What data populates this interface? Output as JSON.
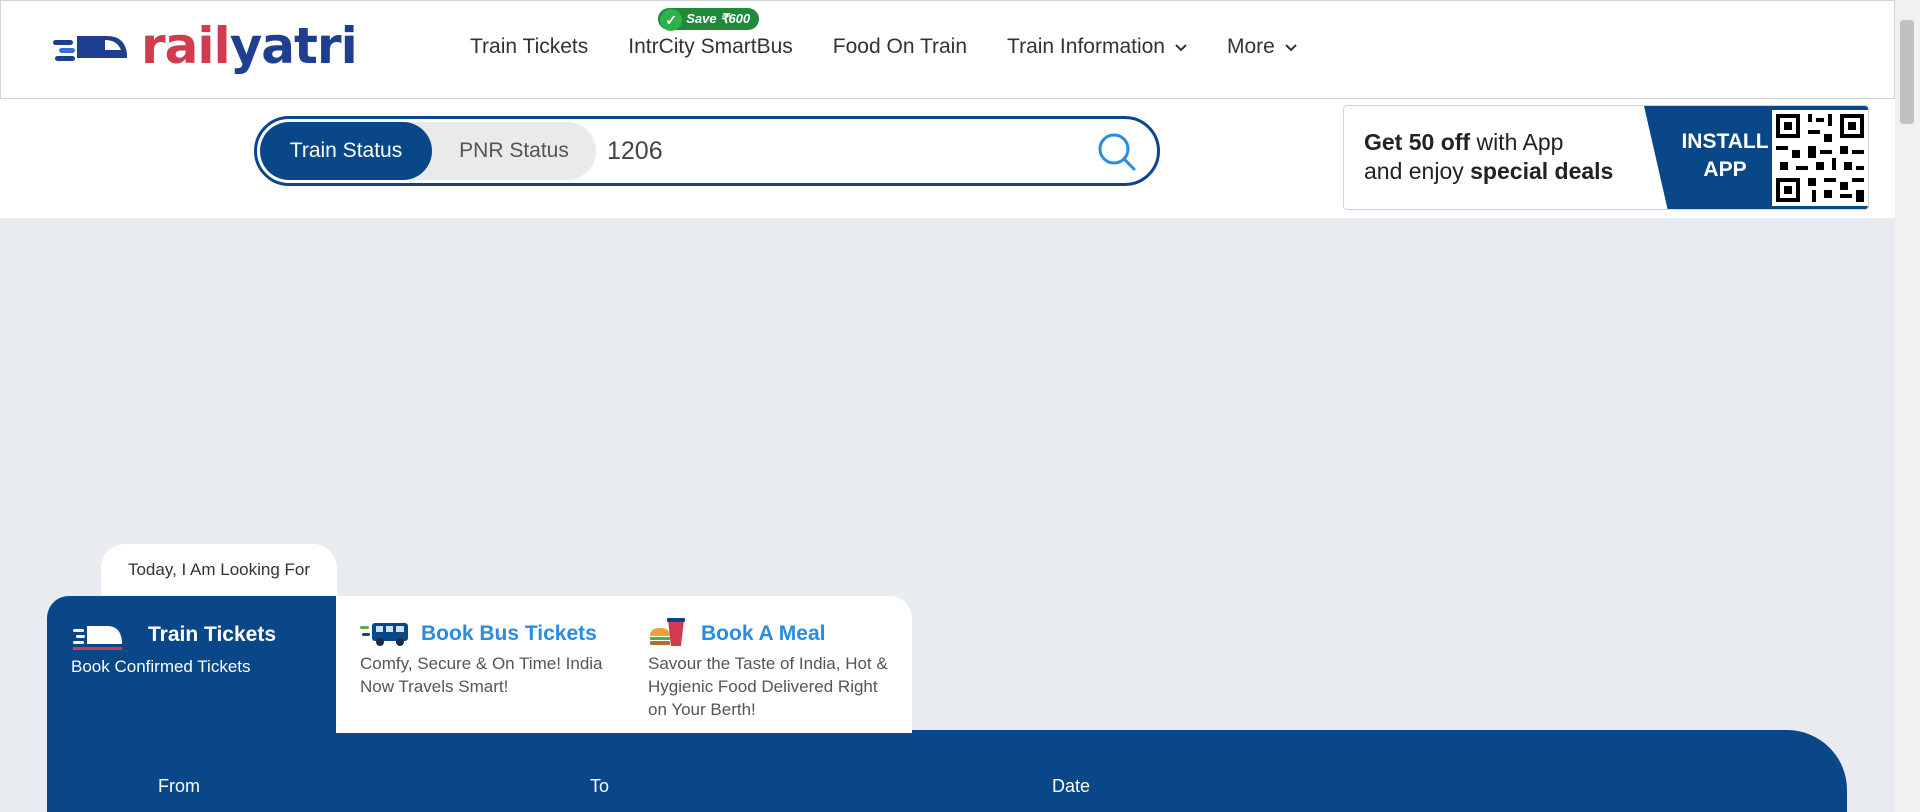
{
  "brand": {
    "part1": "rail",
    "part2": "yatri"
  },
  "nav": {
    "items": [
      {
        "label": "Train Tickets"
      },
      {
        "label": "IntrCity SmartBus",
        "badge": "Save ₹600"
      },
      {
        "label": "Food On Train"
      },
      {
        "label": "Train Information"
      },
      {
        "label": "More"
      }
    ]
  },
  "search": {
    "tabs": [
      "Train Status",
      "PNR Status"
    ],
    "active_tab": "Train Status",
    "value": "1206"
  },
  "app_banner": {
    "line1_bold": "Get 50 off",
    "line1_rest": " with App",
    "line2_rest": "and enjoy ",
    "line2_bold": "special deals",
    "install_line1": "INSTALL",
    "install_line2": "APP"
  },
  "looking_for": "Today, I Am Looking For",
  "services": [
    {
      "title": "Train Tickets",
      "desc": "Book Confirmed Tickets",
      "icon": "train-icon"
    },
    {
      "title": "Book Bus Tickets",
      "desc": "Comfy, Secure & On Time! India Now Travels Smart!",
      "icon": "bus-icon"
    },
    {
      "title": "Book A Meal",
      "desc": "Savour the Taste of India, Hot & Hygienic Food Delivered Right on Your Berth!",
      "icon": "meal-icon"
    }
  ],
  "booking_form": {
    "from_label": "From",
    "to_label": "To",
    "date_label": "Date"
  },
  "colors": {
    "primary": "#0a4788",
    "brand_red": "#d23b4e",
    "badge_green": "#1e8a3a",
    "link_blue": "#2a8be0"
  }
}
